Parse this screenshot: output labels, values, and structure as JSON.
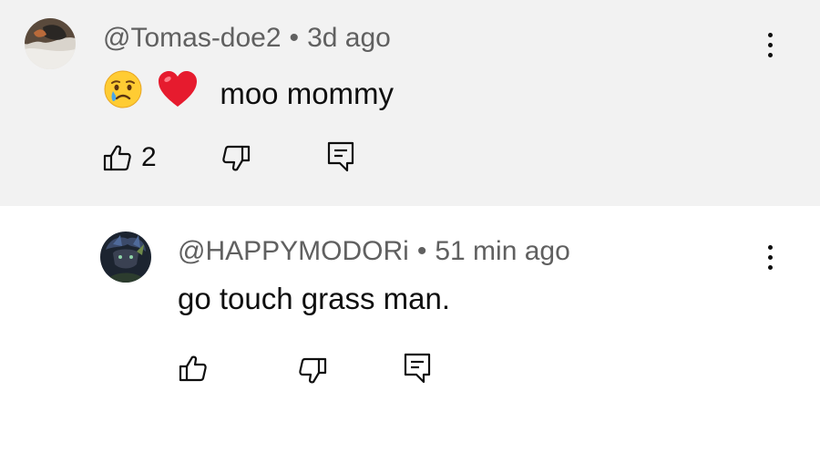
{
  "comments": [
    {
      "author": "@Tomas-doe2",
      "separator": "•",
      "time": "3d ago",
      "text": "moo mommy",
      "emojis": [
        "crying-face",
        "red-heart"
      ],
      "likes": "2"
    },
    {
      "author": "@HAPPYMODORi",
      "separator": "•",
      "time": "51 min ago",
      "text": "go touch grass man.",
      "likes": ""
    }
  ],
  "icons": {
    "like": "thumb-up-icon",
    "dislike": "thumb-down-icon",
    "reply": "reply-icon",
    "more": "more-vert-icon"
  },
  "colors": {
    "highlight_background": "#f2f2f2",
    "meta_text": "#606060",
    "body_text": "#0f0f0f"
  }
}
